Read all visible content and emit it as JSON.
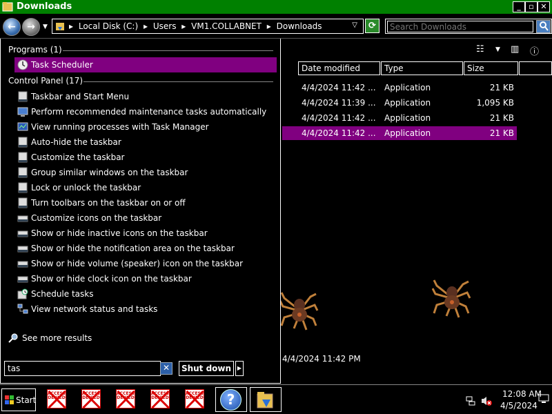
{
  "window": {
    "title": "Downloads"
  },
  "titlebar_buttons": {
    "minimize": "_",
    "maximize": "▫",
    "close": "✕"
  },
  "address": {
    "crumbs": [
      "Local Disk (C:)",
      "Users",
      "VM1.COLLABNET",
      "Downloads"
    ],
    "separator": "▸"
  },
  "search": {
    "placeholder": "Search Downloads"
  },
  "columns": {
    "date": "Date modified",
    "type": "Type",
    "size": "Size"
  },
  "files": [
    {
      "date": "4/4/2024 11:42 ...",
      "type": "Application",
      "size": "21 KB",
      "selected": false
    },
    {
      "date": "4/4/2024 11:39 ...",
      "type": "Application",
      "size": "1,095 KB",
      "selected": false
    },
    {
      "date": "4/4/2024 11:42 ...",
      "type": "Application",
      "size": "21 KB",
      "selected": false
    },
    {
      "date": "4/4/2024 11:42 ...",
      "type": "Application",
      "size": "21 KB",
      "selected": true
    }
  ],
  "details": {
    "date": "4/4/2024 11:42 PM"
  },
  "start_menu": {
    "programs_header": "Programs (1)",
    "programs": [
      {
        "label": "Task Scheduler",
        "icon": "clock-icon",
        "selected": true
      }
    ],
    "control_panel_header": "Control Panel (17)",
    "control_panel": [
      {
        "label": "Taskbar and Start Menu",
        "icon": "taskbar-icon"
      },
      {
        "label": "Perform recommended maintenance tasks automatically",
        "icon": "monitor-icon"
      },
      {
        "label": "View running processes with Task Manager",
        "icon": "task-manager-icon"
      },
      {
        "label": "Auto-hide the taskbar",
        "icon": "taskbar-icon"
      },
      {
        "label": "Customize the taskbar",
        "icon": "taskbar-icon"
      },
      {
        "label": "Group similar windows on the taskbar",
        "icon": "taskbar-icon"
      },
      {
        "label": "Lock or unlock the taskbar",
        "icon": "taskbar-icon"
      },
      {
        "label": "Turn toolbars on the taskbar on or off",
        "icon": "taskbar-icon"
      },
      {
        "label": "Customize icons on the taskbar",
        "icon": "notification-icon"
      },
      {
        "label": "Show or hide inactive icons on the taskbar",
        "icon": "notification-icon"
      },
      {
        "label": "Show or hide the notification area on the taskbar",
        "icon": "notification-icon"
      },
      {
        "label": "Show or hide volume (speaker) icon on the taskbar",
        "icon": "notification-icon"
      },
      {
        "label": "Show or hide clock icon on the taskbar",
        "icon": "notification-icon"
      },
      {
        "label": "Schedule tasks",
        "icon": "schedule-icon"
      },
      {
        "label": "View network status and tasks",
        "icon": "network-icon"
      }
    ],
    "see_more": "See more results",
    "search_value": "tas",
    "clear_glyph": "✕",
    "shutdown_label": "Shut down",
    "shutdown_arrow": "▶"
  },
  "taskbar": {
    "start_label": "Start",
    "denied_text": "ACCESS DENIED",
    "denied_count": 5,
    "help_glyph": "?",
    "clock_time": "12:08 AM",
    "clock_date": "4/5/2024"
  },
  "colors": {
    "titlebar": "#008000",
    "selection": "#800080",
    "background": "#000000",
    "text": "#ffffff"
  }
}
